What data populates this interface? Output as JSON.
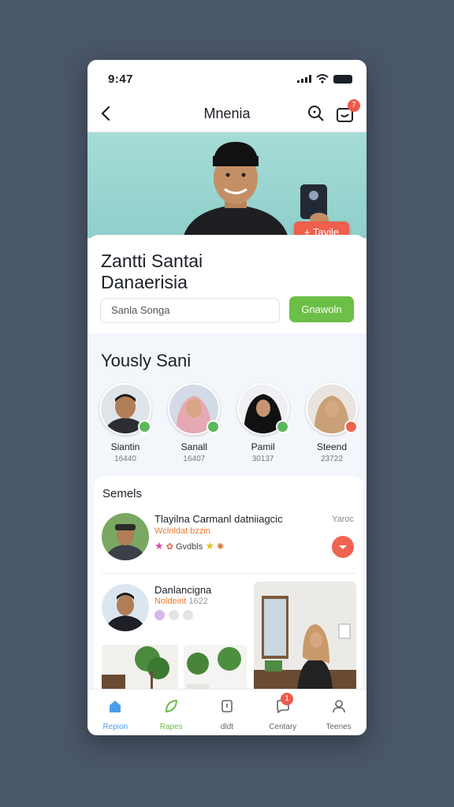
{
  "status": {
    "time": "9:47"
  },
  "nav": {
    "title": "Mnenia",
    "cart_badge": "7"
  },
  "hero": {
    "add_label": "+ Tavile"
  },
  "profile": {
    "name_line1": "Zantti Santai",
    "name_line2": "Danaerisia",
    "input_value": "Sanla Songa",
    "action_label": "Gnawoln"
  },
  "section": {
    "title": "Yously Sani"
  },
  "people": [
    {
      "name": "Siantin",
      "count": "16440",
      "status": "online"
    },
    {
      "name": "Sanall",
      "count": "16407",
      "status": "online"
    },
    {
      "name": "Pamil",
      "count": "30137",
      "status": "online"
    },
    {
      "name": "Steend",
      "count": "23722",
      "status": "busy"
    }
  ],
  "feed": {
    "heading": "Semels",
    "item1": {
      "title": "Tlayilna Carmanl datniiagcic",
      "subtitle": "Wclnldat bzzin",
      "meta": "Gvdbls",
      "right": "Yaroc"
    },
    "item2": {
      "title": "Danlancigna",
      "subtitle": "Noldeint",
      "count": "1622"
    }
  },
  "tabbar": [
    {
      "label": "Repion",
      "active": true
    },
    {
      "label": "Rapes",
      "active": false
    },
    {
      "label": "dldt",
      "active": false
    },
    {
      "label": "Centary",
      "active": false,
      "badge": "1"
    },
    {
      "label": "Teenes",
      "active": false
    }
  ],
  "colors": {
    "accent_red": "#ef5f4c",
    "accent_green": "#6cbf47",
    "accent_blue": "#4a9de8"
  }
}
